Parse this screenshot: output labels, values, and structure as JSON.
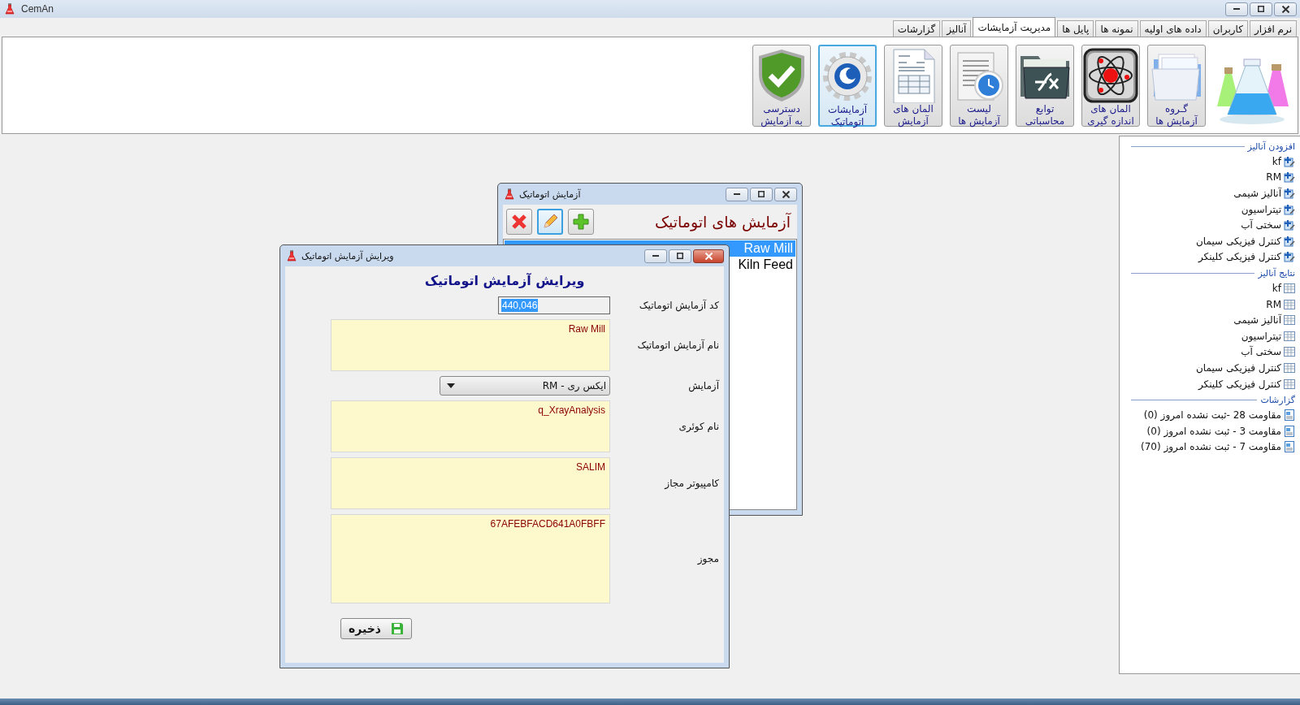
{
  "window": {
    "title": "CemAn"
  },
  "menu_tabs": [
    {
      "label": "نرم افزار",
      "selected": false
    },
    {
      "label": "کاربران",
      "selected": false
    },
    {
      "label": "داده های اولیه",
      "selected": false
    },
    {
      "label": "نمونه ها",
      "selected": false
    },
    {
      "label": "پایل ها",
      "selected": false
    },
    {
      "label": "مدیریت آزمایشات",
      "selected": true
    },
    {
      "label": "آنالیز",
      "selected": false
    },
    {
      "label": "گزارشات",
      "selected": false
    }
  ],
  "ribbon": {
    "buttons": [
      {
        "kind": "folder",
        "label": "گـروه\nآزمایش ها",
        "selected": false
      },
      {
        "kind": "atom",
        "label": "المان های\nاندازه گیری",
        "selected": false
      },
      {
        "kind": "fx",
        "label": "توابع\nمحاسباتی",
        "selected": false
      },
      {
        "kind": "clock",
        "label": "لیست\nآزمایش ها",
        "selected": false
      },
      {
        "kind": "invoice",
        "label": "المان های\nآزمایش",
        "selected": false
      },
      {
        "kind": "gear",
        "label": "آزمایشات\nاتوماتیک",
        "selected": true
      },
      {
        "kind": "shield",
        "label": "دسترسی\nبه آزمایش",
        "selected": false
      }
    ]
  },
  "sidebar": {
    "sections": [
      {
        "title": "افزودن آنالیز",
        "kind": "add",
        "items": [
          "kf",
          "RM",
          "آنالیز شیمی",
          "تیتراسیون",
          "سختی آب",
          "کنترل فیزیکی سیمان",
          "کنترل فیزیکی کلینکر"
        ]
      },
      {
        "title": "نتایج آنالیز",
        "kind": "result",
        "items": [
          "kf",
          "RM",
          "آنالیز شیمی",
          "تیتراسیون",
          "سختی آب",
          "کنترل فیزیکی سیمان",
          "کنترل فیزیکی کلینکر"
        ]
      },
      {
        "title": "گزارشات",
        "kind": "report",
        "items": [
          "مقاومت 28 -ثبت نشده امروز (0)",
          "مقاومت 3 - ثبت نشده امروز (0)",
          "مقاومت 7 - ثبت نشده امروز (70)"
        ]
      }
    ]
  },
  "list_window": {
    "title": "آزمایش اتوماتیک",
    "heading": "آزمایش های اتوماتیک",
    "toolbar": [
      {
        "kind": "delete",
        "focused": false
      },
      {
        "kind": "edit",
        "focused": true
      },
      {
        "kind": "add",
        "focused": false
      }
    ],
    "items": [
      {
        "label": "Raw Mill",
        "selected": true
      },
      {
        "label": "Kiln Feed",
        "selected": false
      }
    ]
  },
  "edit_window": {
    "title": "ویرایش آزمایش اتوماتیک",
    "heading": "ویرایش آزمایش اتوماتیک",
    "fields": [
      {
        "kind": "code",
        "label": "کد آزمایش اتوماتیک",
        "value": "440,046",
        "selected": true
      },
      {
        "kind": "memo",
        "label": "نام آزمایش اتوماتیک",
        "value": "Raw Mill"
      },
      {
        "kind": "dropdown",
        "label": "آزمایش",
        "value": "ایکس ری - RM"
      },
      {
        "kind": "memo",
        "label": "نام کوئری",
        "value": "q_XrayAnalysis"
      },
      {
        "kind": "memo",
        "label": "کامپیوتر مجاز",
        "value": "SALIM"
      },
      {
        "kind": "memo_tall",
        "label": "مجوز",
        "value": "67AFEBFACD641A0FBFF"
      }
    ],
    "save_button": "ذخیره"
  }
}
